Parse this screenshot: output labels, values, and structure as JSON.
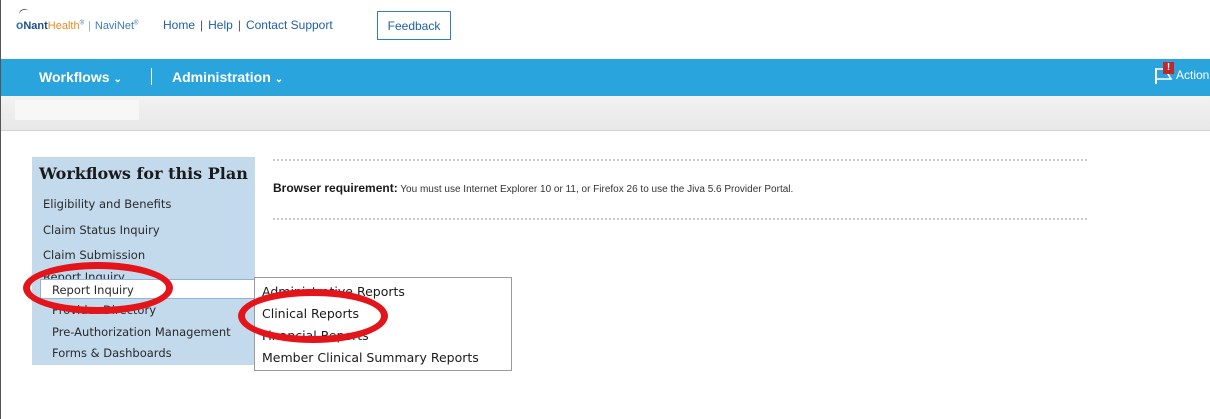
{
  "header": {
    "logo": {
      "o": "o",
      "nant": "Nant",
      "health": "Health",
      "tm": "®",
      "navinet": "NaviNet",
      "tm2": "®"
    },
    "links": [
      "Home",
      "Help",
      "Contact Support"
    ],
    "feedback_label": "Feedback"
  },
  "nav": {
    "workflows_label": "Workflows",
    "administration_label": "Administration",
    "chevron": "⌄",
    "actions_label": "Action",
    "alert_mark": "!"
  },
  "workflows_panel": {
    "title": "Workflows for this Plan",
    "items": [
      "Eligibility and Benefits",
      "Claim Status Inquiry",
      "Claim Submission",
      "Report Inquiry"
    ],
    "sub_items": [
      "Report Inquiry",
      "Provider Directory",
      "Pre-Authorization Management",
      "Forms & Dashboards"
    ]
  },
  "report_submenu": {
    "items": [
      "Administrative Reports",
      "Clinical Reports",
      "Financial Reports",
      "Member Clinical Summary Reports"
    ]
  },
  "notice": {
    "label": "Browser requirement:",
    "text": " You must use Internet Explorer 10 or 11, or Firefox 26 to use the Jiva 5.6 Provider Portal."
  },
  "colors": {
    "nav_bg": "#2aa4dd",
    "panel_bg": "#c3d9ec",
    "annotation_red": "#e4141b",
    "alert_red": "#c0282d"
  }
}
